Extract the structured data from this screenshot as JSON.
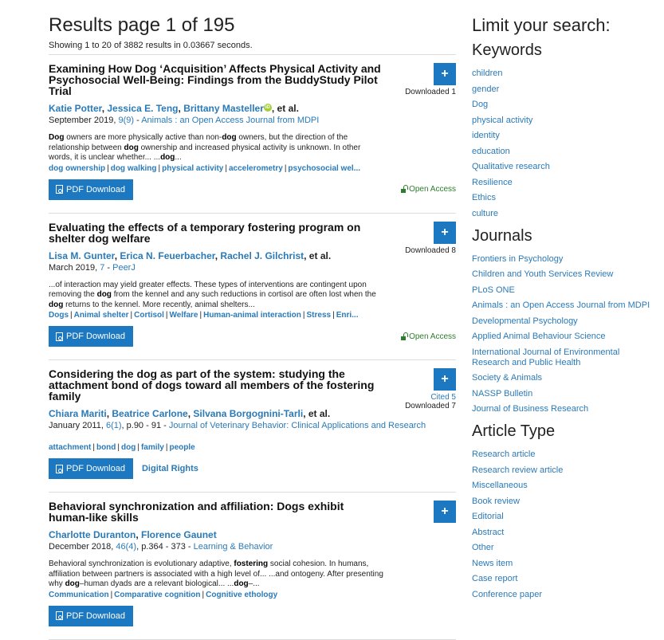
{
  "header": {
    "title": "Results page 1 of 195",
    "summary": "Showing 1 to 20 of 3882 results in 0.03667 seconds."
  },
  "results": [
    {
      "title": "Examining How Dog ‘Acquisition’ Affects Physical Activity and Psychosocial Well-Being: Findings from the BuddyStudy Pilot Trial",
      "authors": [
        "Katie Potter",
        "Jessica E. Teng",
        "Brittany Masteller"
      ],
      "et_al": ", et al.",
      "has_orcid": true,
      "date": "September 2019, ",
      "volume": "9(9)",
      "pages": "",
      "journal_sep": " - ",
      "journal": "Animals : an Open Access Journal from MDPI",
      "snippet_html": "<b>Dog</b> owners are more physically active than non-<b>dog</b> owners, but the direction of the relationship between <b>dog</b> ownership and increased physical activity is unknown. In other words, it is unclear whether... ...<b>dog</b>...",
      "keywords": [
        "dog ownership",
        "dog walking",
        "physical activity",
        "accelerometry",
        "psychosocial wel..."
      ],
      "pdf_label": "PDF Download",
      "digital_rights": "",
      "open_access": "Open Access",
      "cited": "",
      "downloaded": "Downloaded 1",
      "add_label": "+"
    },
    {
      "title": "Evaluating the effects of a temporary fostering program on shelter dog welfare",
      "authors": [
        "Lisa M. Gunter",
        "Erica N. Feuerbacher",
        "Rachel J. Gilchrist"
      ],
      "et_al": ", et al.",
      "has_orcid": false,
      "date": "March 2019, ",
      "volume": "7",
      "pages": "",
      "journal_sep": " - ",
      "journal": "PeerJ",
      "snippet_html": "...of interaction may yield greater effects. These types of interventions are contingent upon removing the <b>dog</b> from the kennel and any such reductions in cortisol are often lost when the <b>dog</b> returns to the kennel. More recently, animal shelters...",
      "keywords": [
        "Dogs",
        "Animal shelter",
        "Cortisol",
        "Welfare",
        "Human-animal interaction",
        "Stress",
        "Enri..."
      ],
      "pdf_label": "PDF Download",
      "digital_rights": "",
      "open_access": "Open Access",
      "cited": "",
      "downloaded": "Downloaded 8",
      "add_label": "+"
    },
    {
      "title": "Considering the dog as part of the system: studying the attachment bond of dogs toward all members of the fostering family",
      "authors": [
        "Chiara Mariti",
        "Beatrice Carlone",
        "Silvana Borgognini-Tarli"
      ],
      "et_al": ", et al.",
      "has_orcid": false,
      "date": "January 2011, ",
      "volume": "6(1)",
      "pages": ", p.90 - 91",
      "journal_sep": " - ",
      "journal": "Journal of Veterinary Behavior: Clinical Applications and Research",
      "snippet_html": "",
      "keywords": [
        "attachment",
        "bond",
        "dog",
        "family",
        "people"
      ],
      "pdf_label": "PDF Download",
      "digital_rights": "Digital Rights",
      "open_access": "",
      "cited": "Cited 5",
      "downloaded": "Downloaded 7",
      "add_label": "+"
    },
    {
      "title": "Behavioral synchronization and affiliation: Dogs exhibit human-like skills",
      "authors": [
        "Charlotte Duranton",
        "Florence Gaunet"
      ],
      "et_al": "",
      "has_orcid": false,
      "date": "December 2018, ",
      "volume": "46(4)",
      "pages": ", p.364 - 373",
      "journal_sep": " - ",
      "journal": "Learning & Behavior",
      "snippet_html": "Behavioral synchronization is evolutionary adaptive, <b>fostering</b> social cohesion. In humans, affiliation between partners is associated with a high level of... ...and ontogeny. After presenting why <b>dog</b>–human dyads are a relevant biological... ...<b>dog</b>–...",
      "keywords": [
        "Communication",
        "Comparative cognition",
        "Cognitive ethology"
      ],
      "pdf_label": "PDF Download",
      "digital_rights": "",
      "open_access": "",
      "cited": "",
      "downloaded": "",
      "add_label": "+"
    }
  ],
  "sidebar": {
    "title": "Limit your search:",
    "keywords_heading": "Keywords",
    "keywords": [
      "children",
      "gender",
      "Dog",
      "physical activity",
      "identity",
      "education",
      "Qualitative research",
      "Resilience",
      "Ethics",
      "culture"
    ],
    "journals_heading": "Journals",
    "journals": [
      "Frontiers in Psychology",
      "Children and Youth Services Review",
      "PLoS ONE",
      "Animals : an Open Access Journal from MDPI",
      "Developmental Psychology",
      "Applied Animal Behaviour Science",
      "International Journal of Environmental Research and Public Health",
      "Society & Animals",
      "NASSP Bulletin",
      "Journal of Business Research"
    ],
    "article_type_heading": "Article Type",
    "article_types": [
      "Research article",
      "Research review article",
      "Miscellaneous",
      "Book review",
      "Editorial",
      "Abstract",
      "Other",
      "News item",
      "Case report",
      "Conference paper"
    ]
  },
  "colors": {
    "link": "#2a7ab8",
    "button": "#1c78c0",
    "open_access": "#2c7d2c",
    "orcid": "#a6ce39"
  }
}
